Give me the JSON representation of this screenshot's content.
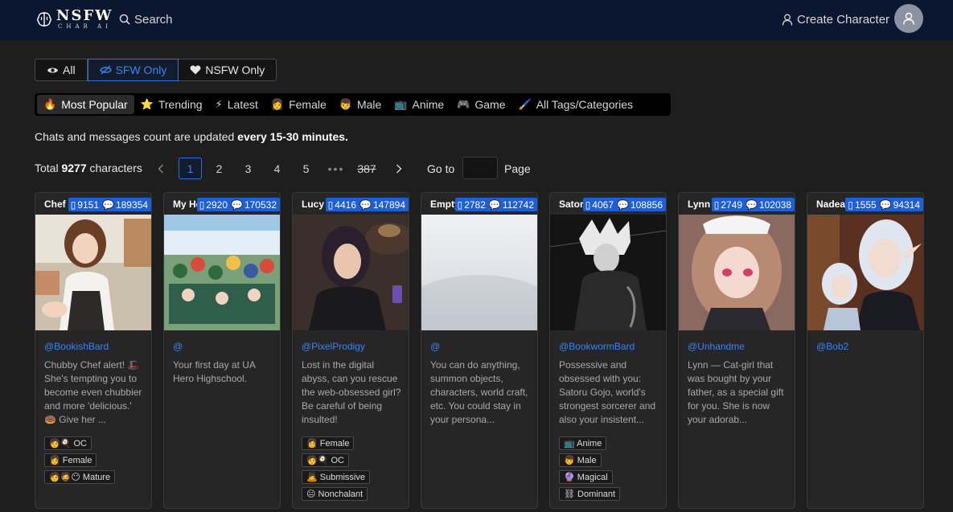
{
  "header": {
    "logo_main": "NSFW",
    "logo_sub": "CHAR AI",
    "search_label": "Search",
    "create_label": "Create Character"
  },
  "filter": {
    "all": "All",
    "sfw": "SFW Only",
    "nsfw": "NSFW Only",
    "active": "sfw"
  },
  "categories": [
    {
      "icon": "🔥",
      "label": "Most Popular",
      "active": true
    },
    {
      "icon": "⭐",
      "label": "Trending"
    },
    {
      "icon": "⚡",
      "label": "Latest"
    },
    {
      "icon": "👩",
      "label": "Female"
    },
    {
      "icon": "👦",
      "label": "Male"
    },
    {
      "icon": "📺",
      "label": "Anime"
    },
    {
      "icon": "🎮",
      "label": "Game"
    },
    {
      "icon": "🖌️",
      "label": "All Tags/Categories"
    }
  ],
  "notice": {
    "prefix": "Chats and messages count are updated ",
    "bold": "every 15-30 minutes."
  },
  "pagination": {
    "total_prefix": "Total ",
    "total_count": "9277",
    "total_suffix": " characters",
    "pages": [
      "1",
      "2",
      "3",
      "4",
      "5",
      "•••",
      "387"
    ],
    "current": "1",
    "goto_label": "Go to",
    "goto_value": "",
    "page_label": "Page"
  },
  "colors": {
    "accent": "#3b82f6",
    "header_bg": "#0b1730",
    "stat_badge": "#1d5fd8"
  },
  "cards": [
    {
      "name": "Chef Laura",
      "messages": "9151",
      "chats": "189354",
      "author": "@BookishBard",
      "desc": "Chubby Chef alert! 🎩 She's tempting you to become even chubbier and more 'delicious.' 🍩 Give her ...",
      "tags": [
        "🧑🍳 OC",
        "👩 Female",
        "🧑🧔😶 Mature"
      ]
    },
    {
      "name": "My Hero Academia",
      "messages": "2920",
      "chats": "170532",
      "author": "@",
      "desc": "Your first day at UA Hero Highschool.",
      "tags": []
    },
    {
      "name": "Lucy",
      "messages": "4416",
      "chats": "147894",
      "author": "@PixelProdigy",
      "desc": "Lost in the digital abyss, can you rescue the web-obsessed girl? Be careful of being insulted!",
      "tags": [
        "👩 Female",
        "🧑🍳 OC",
        "🙇 Submissive",
        "😐 Nonchalant"
      ]
    },
    {
      "name": "Empty Scenario",
      "messages": "2782",
      "chats": "112742",
      "author": "@",
      "desc": "You can do anything, summon objects, characters, world craft, etc. You could stay in your persona...",
      "tags": []
    },
    {
      "name": "Satoru Gojo",
      "messages": "4067",
      "chats": "108856",
      "author": "@BookwormBard",
      "desc": "Possessive and obsessed with you: Satoru Gojo, world's strongest sorcerer and also your insistent...",
      "tags": [
        "📺 Anime",
        "👦 Male",
        "🔮 Magical",
        "⛓ Dominant"
      ]
    },
    {
      "name": "Lynn",
      "messages": "2749",
      "chats": "102038",
      "author": "@Unhandme",
      "desc": "Lynn — Cat-girl that was bought by your father, as a special gift for you. She is now your adorab...",
      "tags": []
    },
    {
      "name": "Nadea",
      "messages": "1555",
      "chats": "94314",
      "author": "@Bob2",
      "desc": "",
      "tags": []
    }
  ]
}
